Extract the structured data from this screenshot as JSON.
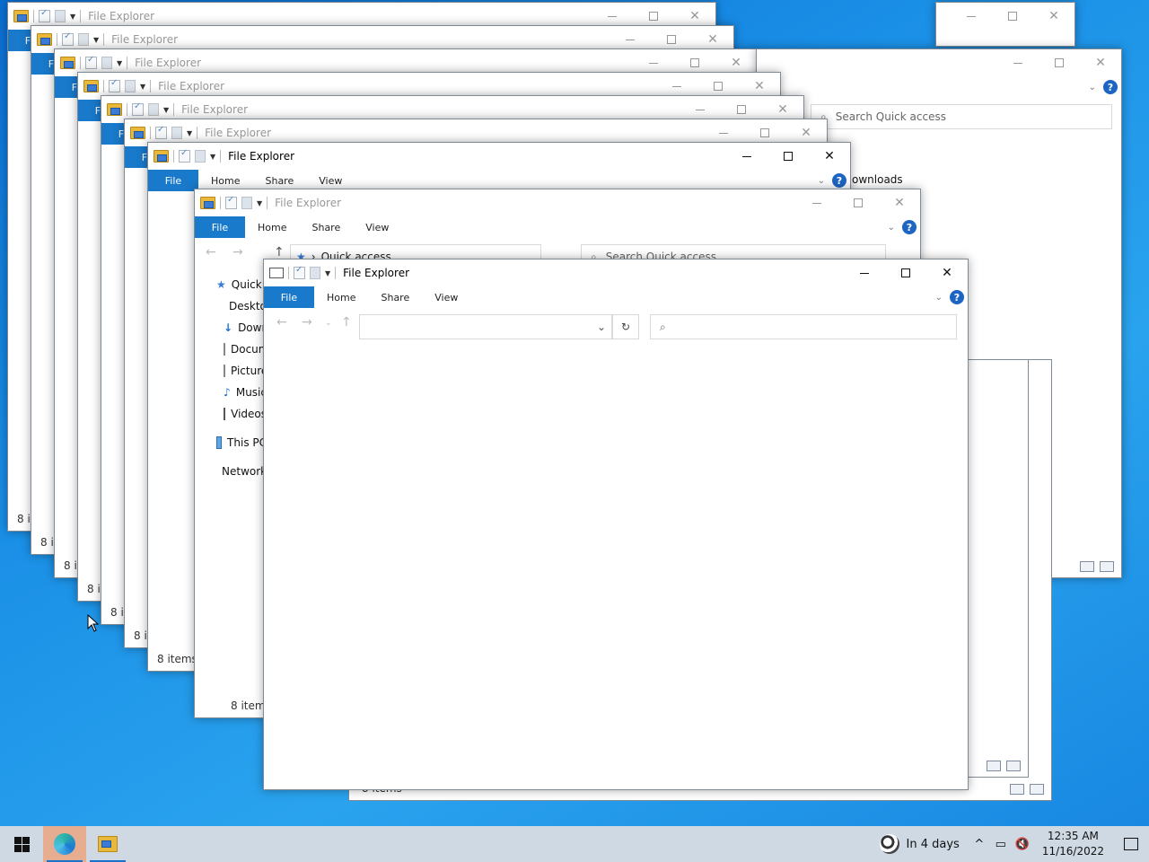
{
  "window_title": "File Explorer",
  "ribbon": {
    "file": "File",
    "home": "Home",
    "share": "Share",
    "view": "View"
  },
  "address": {
    "quick_access": "Quick access",
    "search_placeholder": "Search Quick access"
  },
  "nav": {
    "quick": "Quick access",
    "desktop": "Desktop",
    "downloads": "Downloads",
    "documents": "Documents",
    "pictures": "Pictures",
    "music": "Music",
    "videos": "Videos",
    "this_pc": "This PC",
    "network": "Network"
  },
  "behind_downloads": "ownloads",
  "status_items": "8 items",
  "taskbar": {
    "weather": "In 4 days",
    "time": "12:35 AM",
    "date": "11/16/2022"
  },
  "colors": {
    "accent": "#1979ca",
    "help": "#1c65c4"
  }
}
